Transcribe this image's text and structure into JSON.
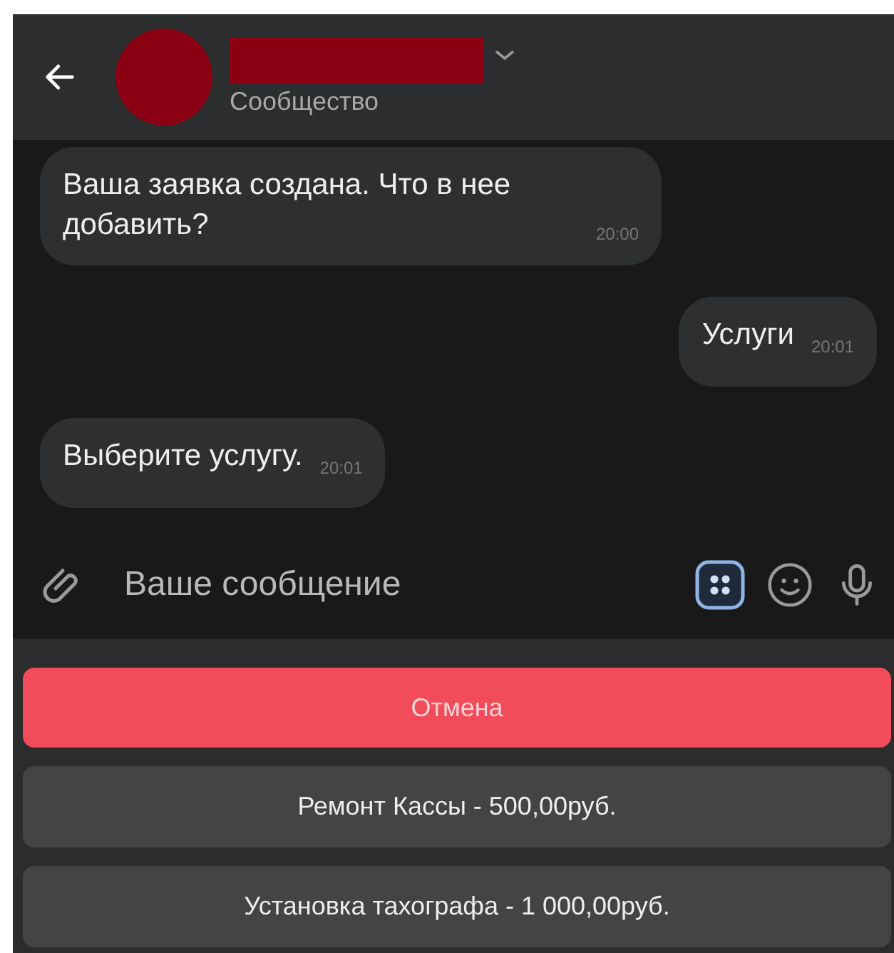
{
  "header": {
    "subtitle": "Сообщество"
  },
  "messages": [
    {
      "kind": "incoming",
      "text": "Ваша заявка создана. Что в нее добавить?",
      "time": "20:00"
    },
    {
      "kind": "outgoing",
      "text": "Услуги",
      "time": "20:01"
    },
    {
      "kind": "incoming",
      "text": "Выберите услугу.",
      "time": "20:01"
    }
  ],
  "composer": {
    "placeholder": "Ваше сообщение",
    "keyboard_active": true
  },
  "buttons": [
    {
      "kind": "negative",
      "label": "Отмена"
    },
    {
      "kind": "secondary",
      "label": "Ремонт Кассы - 500,00руб."
    },
    {
      "kind": "secondary",
      "label": "Установка тахографа - 1 000,00руб."
    }
  ]
}
